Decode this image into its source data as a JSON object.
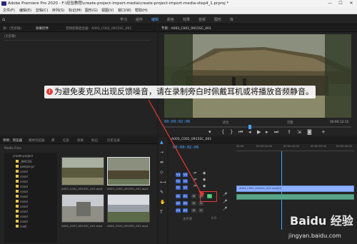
{
  "titlebar": {
    "title": "Adobe Premiere Pro 2020 - F:\\经验教程\\create-project-import-media\\create-project-import-media-step4_1.prproj *",
    "minimize": "—",
    "maximize": "☐",
    "close": "✕"
  },
  "menubar": {
    "items": [
      "文件(F)",
      "编辑(E)",
      "剪辑(C)",
      "序列(S)",
      "标记(M)",
      "图形(G)",
      "视图(V)",
      "窗口(W)",
      "帮助(H)"
    ]
  },
  "workspace": {
    "tabs": [
      "学习",
      "组件",
      "编辑",
      "颜色",
      "效果",
      "音频",
      "图形",
      "库"
    ],
    "active_index": 2
  },
  "source_panel": {
    "tabs": [
      "源：(无剪辑)",
      "效果控件",
      "音频剪辑混合器：A003_C002_0915SC_001"
    ],
    "header": "(无剪辑)"
  },
  "program_panel": {
    "tab": "节目：A003_C002_0915SC_001",
    "timecode_left": "00:00:02:06",
    "fit": "适合",
    "quality": "完整",
    "timecode_right": "00:00:12:15"
  },
  "project_panel": {
    "tabs": [
      "项目：浏览器",
      "媒体浏览器",
      "库",
      "信息",
      "效果",
      "标记",
      "历史记录"
    ],
    "path": "Media Files",
    "tree_root": "create-project",
    "tree_items": [
      "_MACOS",
      "sample-pr",
      "conal",
      "conal",
      "conal",
      "conal",
      "conal",
      "conal",
      "conal",
      "conal",
      "conal",
      "conal",
      "conal",
      "snell"
    ],
    "thumbs": [
      {
        "label": "A003_C001_0915SC_001.mp4",
        "duration": "5:15"
      },
      {
        "label": "A003_C002_0915SC_001.mp4",
        "duration": "12:15"
      },
      {
        "label": "A004_C003_0915SC_001.mp4",
        "duration": "5:15"
      },
      {
        "label": "A004_C010_0915SC_001.mp4",
        "duration": "14:07"
      }
    ]
  },
  "timeline_panel": {
    "tab": "A003_C002_0915SC_001",
    "timecode": "00:00:02:06",
    "ruler": [
      "00:00",
      "00:00:01:00",
      "00:00:02:00",
      "00:00:03:00",
      "00:00:04:00"
    ],
    "tracks_video": [
      "V3",
      "V2",
      "V1"
    ],
    "tracks_audio": [
      "A1",
      "A2",
      "A3"
    ],
    "master": "主声道",
    "master_value": "0.0",
    "video_clip": "A003_C002_0915SC_001.mp4[V]",
    "record_label": "R",
    "mute_label": "M",
    "solo_label": "S"
  },
  "overlay": {
    "badge": "!",
    "message": "为避免麦克风出现反馈噪音，请在录制旁白时佩戴耳机或将播放音频静音。"
  },
  "watermark": {
    "text": "jingyan.baidu.com",
    "brand": "Baidu 经验"
  },
  "colors": {
    "accent": "#4aa3ff",
    "record": "#3fbf6a",
    "highlight_box": "#e53935"
  }
}
